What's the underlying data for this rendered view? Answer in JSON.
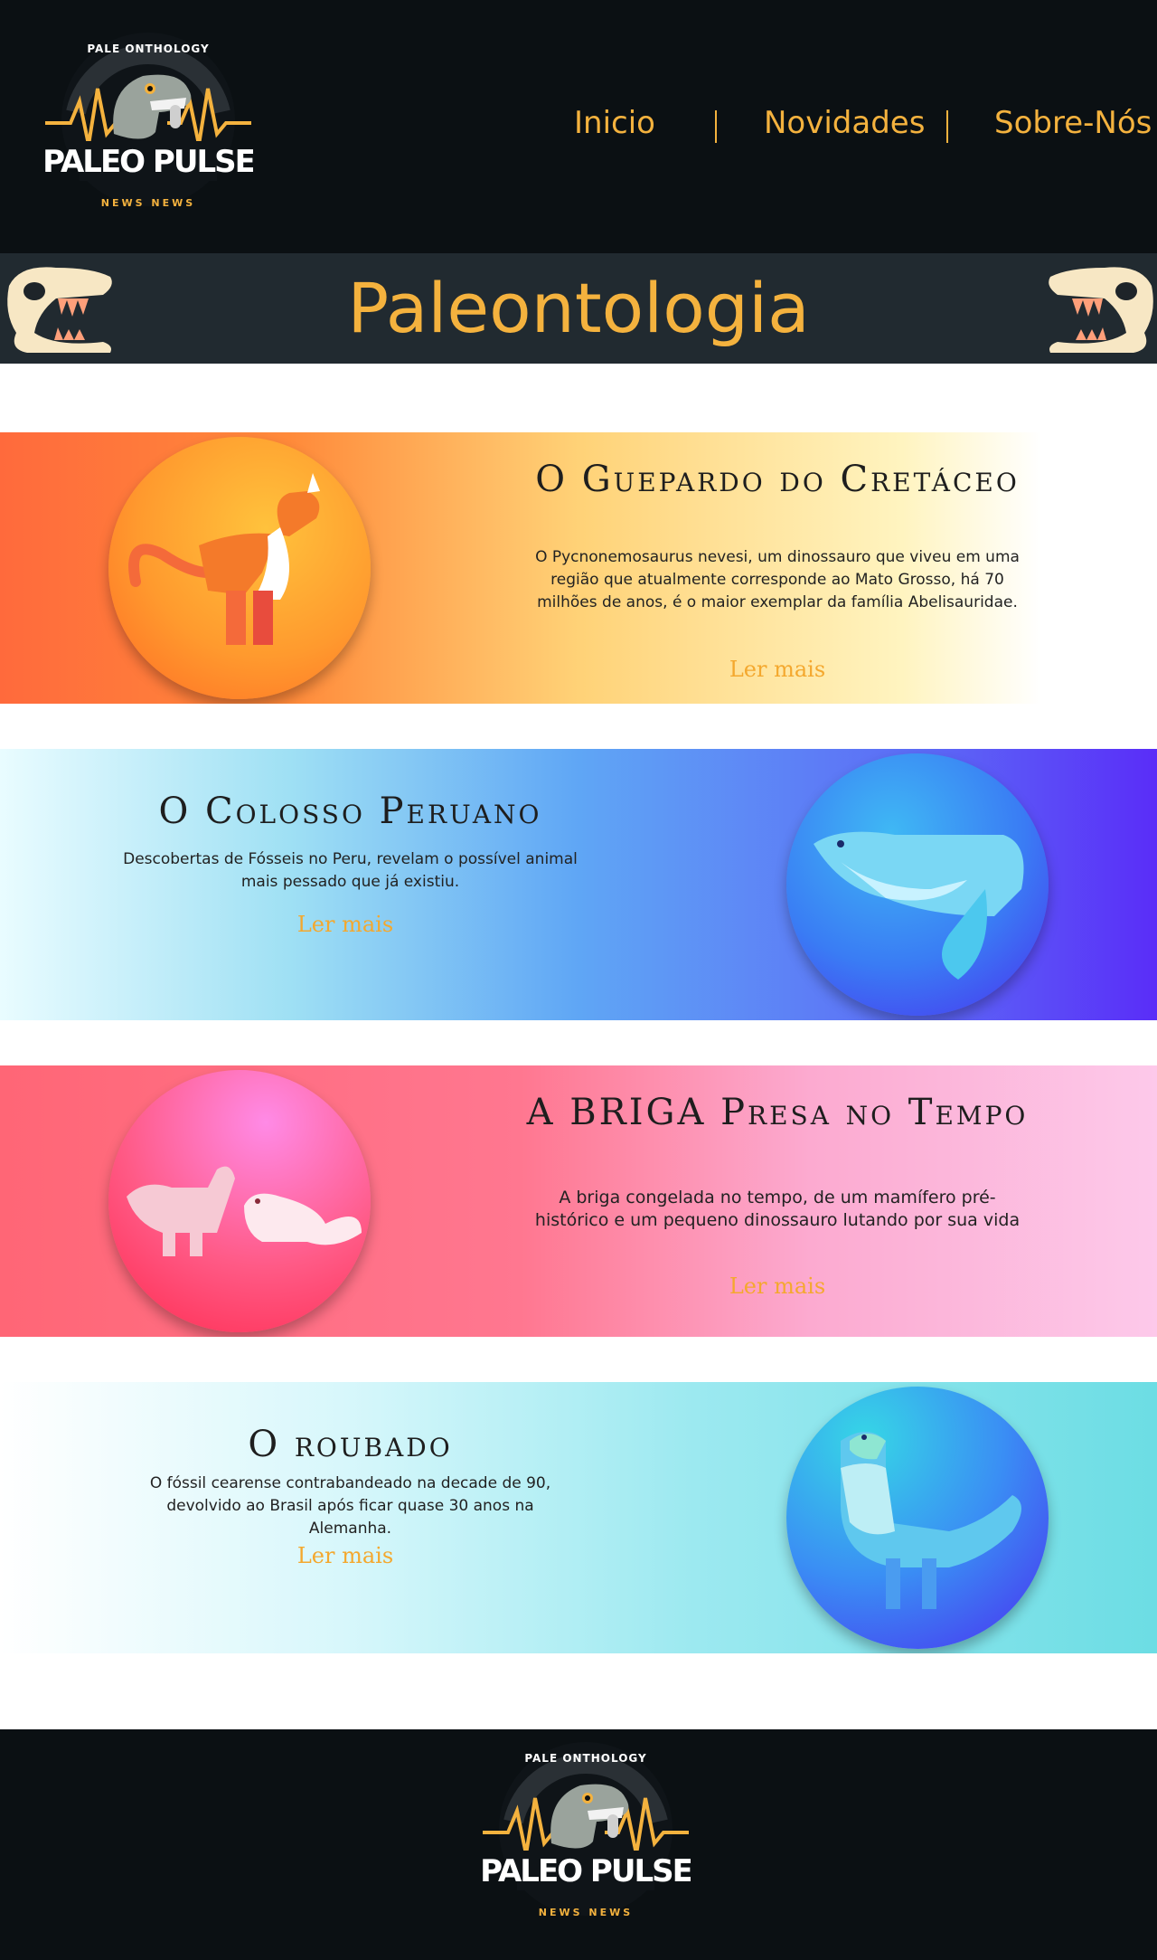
{
  "header": {
    "logo": {
      "top_text": "PALE ONTHOLOGY",
      "main_text": "PALEO PULSE",
      "bottom_text": "NEWS NEWS"
    },
    "nav": [
      {
        "label": "Inicio"
      },
      {
        "label": "Novidades"
      },
      {
        "label": "Sobre-Nós"
      }
    ]
  },
  "page_title": "Paleontologia",
  "cards": [
    {
      "title": "O Guepardo do Cretáceo",
      "description": "O Pycnonemosaurus nevesi, um dinossauro que viveu em uma região que atualmente corresponde ao Mato Grosso, há 70 milhões de anos, é o maior exemplar da família Abelisauridae.",
      "link": "Ler mais",
      "icon": "dinosaur-icon"
    },
    {
      "title": "O Colosso Peruano",
      "description": "Descobertas de Fósseis  no Peru, revelam o possível animal mais pessado que já existiu.",
      "link": "Ler mais",
      "icon": "whale-icon"
    },
    {
      "title": "A BRIGA Presa no Tempo",
      "description": "A briga congelada no tempo, de um mamífero pré-histórico e um pequeno dinossauro lutando por sua vida",
      "link": "Ler mais",
      "icon": "fighting-animals-icon"
    },
    {
      "title": "O roubado",
      "description": "O fóssil cearense contrabandeado na decade de 90,  devolvido ao Brasil após ficar quase 30 anos na Alemanha.",
      "link": "Ler mais",
      "icon": "feathered-dinosaur-icon"
    }
  ],
  "footer": {
    "logo": {
      "top_text": "PALE ONTHOLOGY",
      "main_text": "PALEO PULSE",
      "bottom_text": "NEWS NEWS"
    }
  },
  "colors": {
    "accent": "#f4b23e",
    "dark": "#0b1013",
    "band": "#212a30"
  }
}
